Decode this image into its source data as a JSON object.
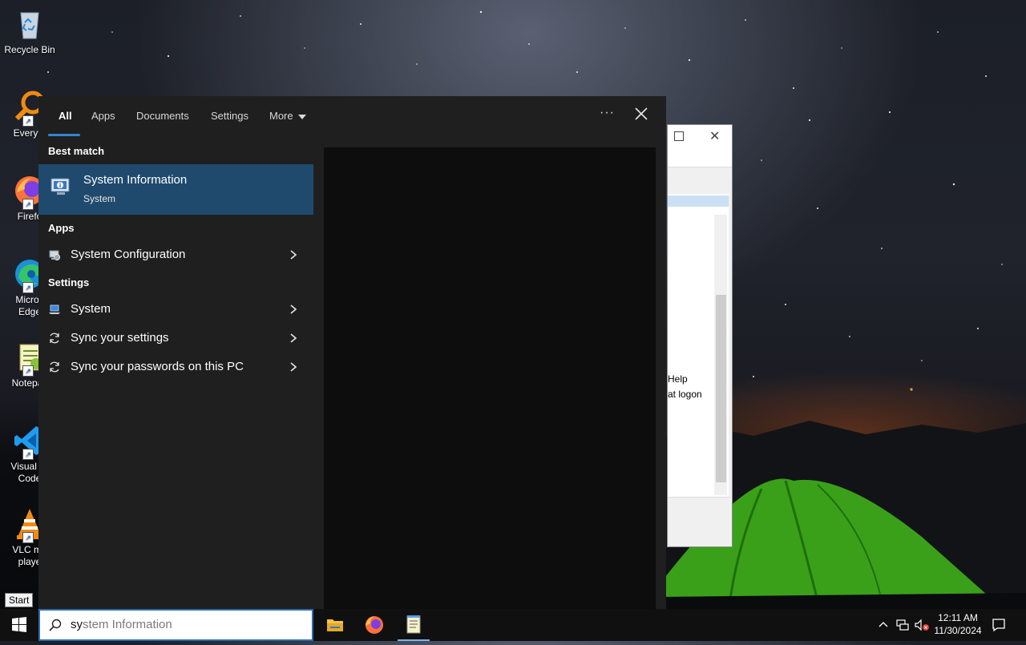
{
  "desktop": {
    "icons": [
      {
        "label": "Recycle Bin",
        "icon": "recycle-bin-icon"
      },
      {
        "label": "Everyth",
        "icon": "everything-search-icon"
      },
      {
        "label": "Firefo",
        "icon": "firefox-icon"
      },
      {
        "label": "Micros Edge",
        "label_line1": "Micros",
        "label_line2": "Edge",
        "icon": "edge-icon"
      },
      {
        "label": "Notepac",
        "icon": "notepad-plus-plus-icon"
      },
      {
        "label": "Visual St Code",
        "label_line1": "Visual St",
        "label_line2": "Code",
        "icon": "vscode-icon"
      },
      {
        "label": "VLC me playe",
        "label_line1": "VLC me",
        "label_line2": "playe",
        "icon": "vlc-icon"
      }
    ]
  },
  "background_window": {
    "text_help": "Help",
    "text_logon": "at logon"
  },
  "search_panel": {
    "tabs": [
      {
        "label": "All",
        "active": true
      },
      {
        "label": "Apps"
      },
      {
        "label": "Documents"
      },
      {
        "label": "Settings"
      },
      {
        "label": "More"
      }
    ],
    "more_options": "···",
    "best_match": {
      "heading": "Best match",
      "title": "System Information",
      "subtitle": "System",
      "icon": "system-information-icon"
    },
    "apps": {
      "heading": "Apps",
      "items": [
        {
          "label": "System Configuration",
          "icon": "system-configuration-icon"
        }
      ]
    },
    "settings": {
      "heading": "Settings",
      "items": [
        {
          "label": "System",
          "icon": "system-laptop-icon"
        },
        {
          "label": "Sync your settings",
          "icon": "sync-icon"
        },
        {
          "label": "Sync your passwords on this PC",
          "icon": "sync-icon"
        }
      ]
    }
  },
  "search_box": {
    "typed": "sy",
    "suggestion_rest": "stem Information"
  },
  "tooltip": "Start",
  "taskbar": {
    "apps": [
      {
        "name": "File Explorer",
        "icon": "file-explorer-icon"
      },
      {
        "name": "Firefox",
        "icon": "firefox-icon"
      },
      {
        "name": "Notepad",
        "icon": "notepad-icon",
        "active": true
      }
    ],
    "clock_time": "12:11 AM",
    "clock_date": "11/30/2024"
  },
  "colors": {
    "panel_bg": "#1f1f1f",
    "selected_bg": "#1f4a6e",
    "accent": "#2b88d8",
    "taskbar_bg": "#101010"
  }
}
